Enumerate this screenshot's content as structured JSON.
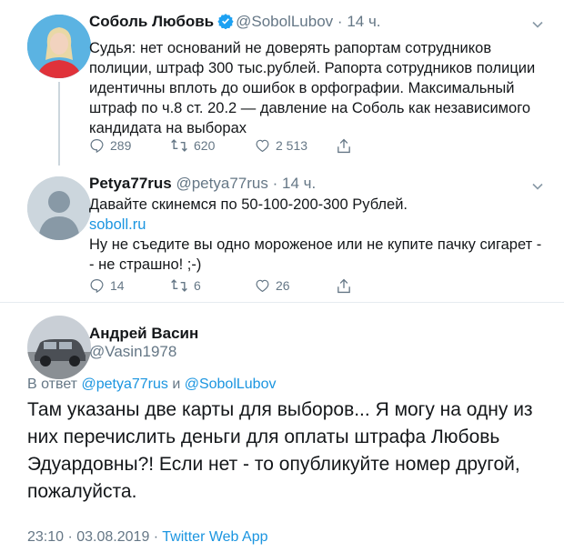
{
  "tweet1": {
    "name": "Соболь Любовь",
    "handle": "@SobolLubov",
    "dot": "·",
    "time": "14 ч.",
    "text": "Судья: нет оснований не доверять рапортам сотрудников полиции, штраф 300 тыс.рублей. Рапорта сотрудников полиции идентичны вплоть до ошибок в орфографии. Максимальный штраф по ч.8 ст. 20.2 — давление на Соболь как независимого кандидата на выборах",
    "replies": "289",
    "retweets": "620",
    "likes": "2 513"
  },
  "tweet2": {
    "name": "Petya77rus",
    "handle": "@petya77rus",
    "dot": "·",
    "time": "14 ч.",
    "line1": "Давайте скинемся по 50-100-200-300 Рублей.",
    "link": "soboll.ru",
    "line2": "Ну не съедите вы одно мороженое или не купите пачку сигарет -- не страшно! ;-)",
    "replies": "14",
    "retweets": "6",
    "likes": "26"
  },
  "tweet3": {
    "name": "Андрей Васин",
    "handle": "@Vasin1978",
    "reply_prefix": "В ответ",
    "reply_user1": "@petya77rus",
    "reply_and": "и",
    "reply_user2": "@SobolLubov",
    "text": "Там указаны две карты для выборов... Я могу на одну из них перечислить деньги для оплаты штрафа Любовь Эдуардовны?! Если нет - то опубликуйте номер другой, пожалуйста.",
    "timestamp": "23:10 · 03.08.2019",
    "sep": "·",
    "source": "Twitter Web App"
  },
  "colors": {
    "accent": "#1b95e0",
    "muted": "#657786",
    "text": "#14171a",
    "divider": "#e6ecf0"
  }
}
